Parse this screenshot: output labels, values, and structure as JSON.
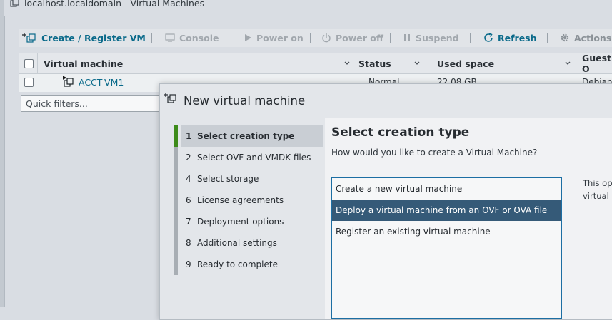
{
  "window": {
    "title": "localhost.localdomain - Virtual Machines"
  },
  "toolbar": {
    "create_label": "Create / Register VM",
    "console_label": "Console",
    "power_on_label": "Power on",
    "power_off_label": "Power off",
    "suspend_label": "Suspend",
    "refresh_label": "Refresh",
    "actions_label": "Actions"
  },
  "grid": {
    "columns": [
      "Virtual machine",
      "Status",
      "Used space",
      "Guest O"
    ],
    "rows": [
      {
        "name": "ACCT-VM1",
        "status": "Normal",
        "used_space": "22.08 GB",
        "guest": "Debian"
      }
    ]
  },
  "filter": {
    "placeholder": "Quick filters..."
  },
  "modal": {
    "title": "New virtual machine",
    "steps": [
      {
        "num": "1",
        "label": "Select creation type",
        "active": true
      },
      {
        "num": "2",
        "label": "Select OVF and VMDK files"
      },
      {
        "num": "4",
        "label": "Select storage"
      },
      {
        "num": "6",
        "label": "License agreements"
      },
      {
        "num": "7",
        "label": "Deployment options"
      },
      {
        "num": "8",
        "label": "Additional settings"
      },
      {
        "num": "9",
        "label": "Ready to complete"
      }
    ],
    "heading": "Select creation type",
    "question": "How would you like to create a Virtual Machine?",
    "options": [
      "Create a new virtual machine",
      "Deploy a virtual machine from an OVF or OVA file",
      "Register an existing virtual machine"
    ],
    "selected_index": 1,
    "description_lines": [
      "This op",
      "virtual m"
    ]
  },
  "colors": {
    "accent": "#0a6a8a",
    "selection": "#355a78",
    "step_active": "#3d8b1a"
  }
}
